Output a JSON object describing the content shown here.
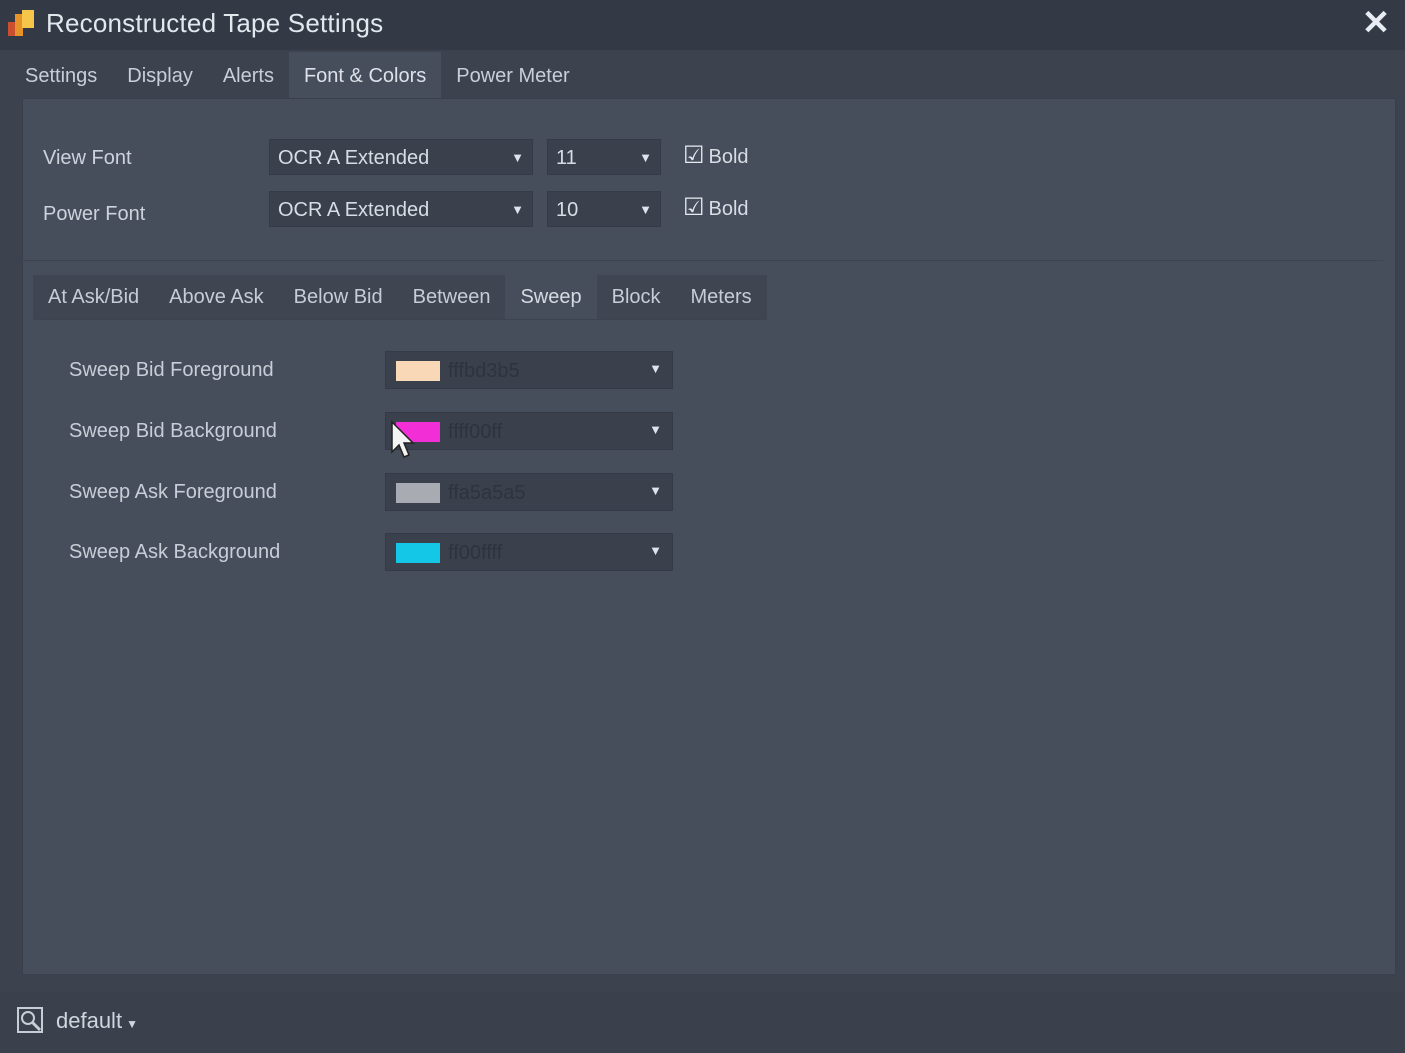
{
  "window": {
    "title": "Reconstructed Tape Settings",
    "close_icon": "close-icon",
    "app_icon": "app-icon"
  },
  "main_tabs": [
    {
      "label": "Settings"
    },
    {
      "label": "Display"
    },
    {
      "label": "Alerts"
    },
    {
      "label": "Font & Colors",
      "active": true
    },
    {
      "label": "Power Meter"
    }
  ],
  "fonts": {
    "view": {
      "label": "View Font",
      "family": "OCR A Extended",
      "size": "11",
      "bold_label": "Bold",
      "bold_checked": true
    },
    "power": {
      "label": "Power Font",
      "family": "OCR A Extended",
      "size": "10",
      "bold_label": "Bold",
      "bold_checked": true
    }
  },
  "sub_tabs": [
    {
      "label": "At Ask/Bid"
    },
    {
      "label": "Above Ask"
    },
    {
      "label": "Below Bid"
    },
    {
      "label": "Between"
    },
    {
      "label": "Sweep",
      "active": true
    },
    {
      "label": "Block"
    },
    {
      "label": "Meters"
    }
  ],
  "colors": [
    {
      "label": "Sweep Bid Foreground",
      "hex": "fffbd3b5",
      "swatch": "#f8d8b6"
    },
    {
      "label": "Sweep Bid Background",
      "hex": "ffff00ff",
      "swatch": "#f22fd6"
    },
    {
      "label": "Sweep Ask Foreground",
      "hex": "ffa5a5a5",
      "swatch": "#a9abb2"
    },
    {
      "label": "Sweep Ask Background",
      "hex": "ff00ffff",
      "swatch": "#14c7e6"
    }
  ],
  "footer": {
    "profile": "default"
  },
  "theme": {
    "background": "#3c434f",
    "panel": "#464e5b"
  }
}
